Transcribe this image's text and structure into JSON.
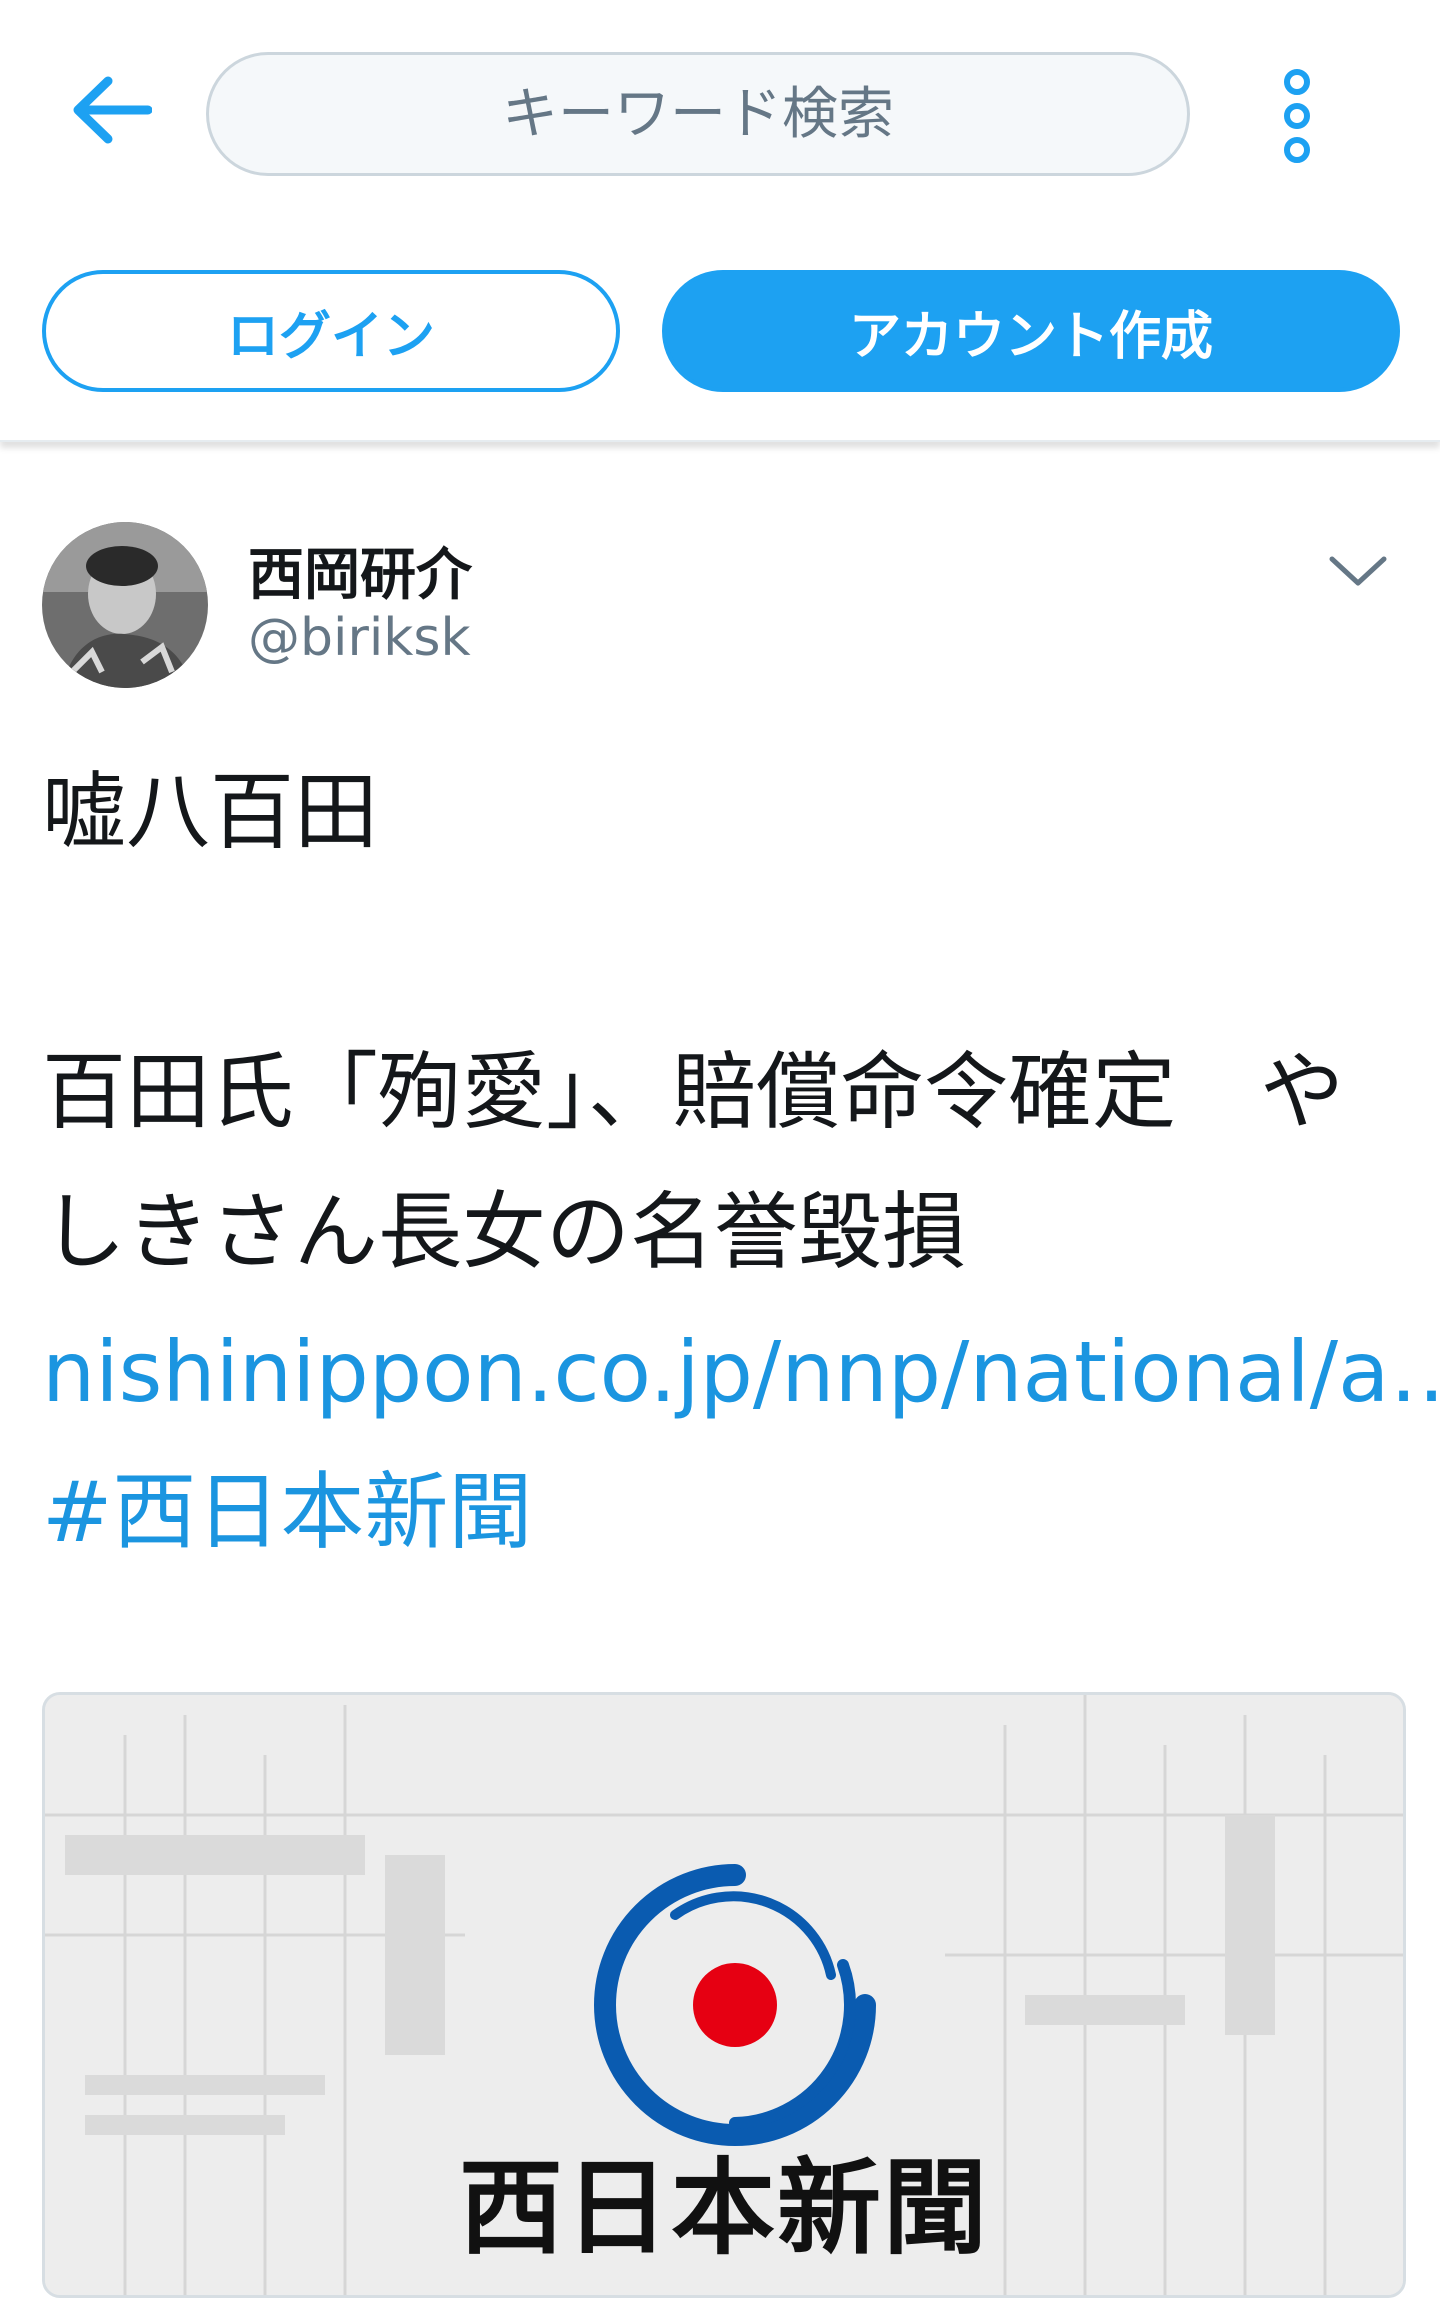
{
  "header": {
    "back_icon": "arrow-left-icon",
    "search_placeholder": "キーワード検索",
    "more_icon": "vertical-ellipsis-icon",
    "login_label": "ログイン",
    "signup_label": "アカウント作成",
    "accent_color": "#1da1f2"
  },
  "tweet": {
    "user_name": "西岡研介",
    "user_handle": "@biriksk",
    "caret_icon": "chevron-down-icon",
    "text_line1": "嘘八百田",
    "text_line2": "百田氏「殉愛」、賠償命令確定　やしきさん長女の名誉毀損",
    "link_text": "nishinippon.co.jp/nnp/national/a…",
    "hashtag": "#西日本新聞"
  },
  "card": {
    "logo_text": "西日本新聞",
    "logo_icon": "nishinippon-logo-icon",
    "logo_red": "#e60012",
    "logo_blue": "#0a5bb0"
  }
}
